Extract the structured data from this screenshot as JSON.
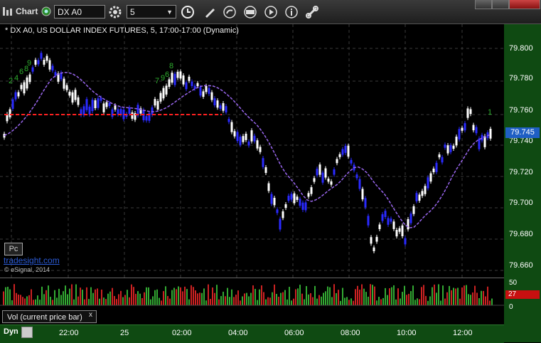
{
  "toolbar": {
    "app_label": "Chart",
    "symbol": "DX A0",
    "interval": "5"
  },
  "chart": {
    "title": "* DX A0, US DOLLAR INDEX FUTURES, 5, 17:00-17:00 (Dynamic)",
    "brand": "tradesight.com",
    "copyright": "© eSignal, 2014",
    "pc_button": "Pc",
    "current_price": "79.745",
    "price_labels": [
      "79.800",
      "79.780",
      "79.760",
      "79.740",
      "79.720",
      "79.700",
      "79.680",
      "79.660"
    ],
    "counts": [
      "2",
      "4",
      "6",
      "8",
      "9",
      "7",
      "9",
      "6",
      "8",
      "1"
    ]
  },
  "volume": {
    "title": "Vol (current price bar)",
    "close": "x",
    "labels": [
      "50",
      "0"
    ],
    "current": "27"
  },
  "timeaxis": {
    "dyn": "Dyn",
    "labels": [
      "22:00",
      "25",
      "02:00",
      "04:00",
      "06:00",
      "08:00",
      "10:00",
      "12:00"
    ]
  },
  "colors": {
    "up_bar": "#ffffff",
    "down_bar": "#2a2aff",
    "average": "#9966ee",
    "level": "#ff2020",
    "vol_up": "#33aa33",
    "vol_down": "#cc2222",
    "panel": "#0f4a12"
  }
}
